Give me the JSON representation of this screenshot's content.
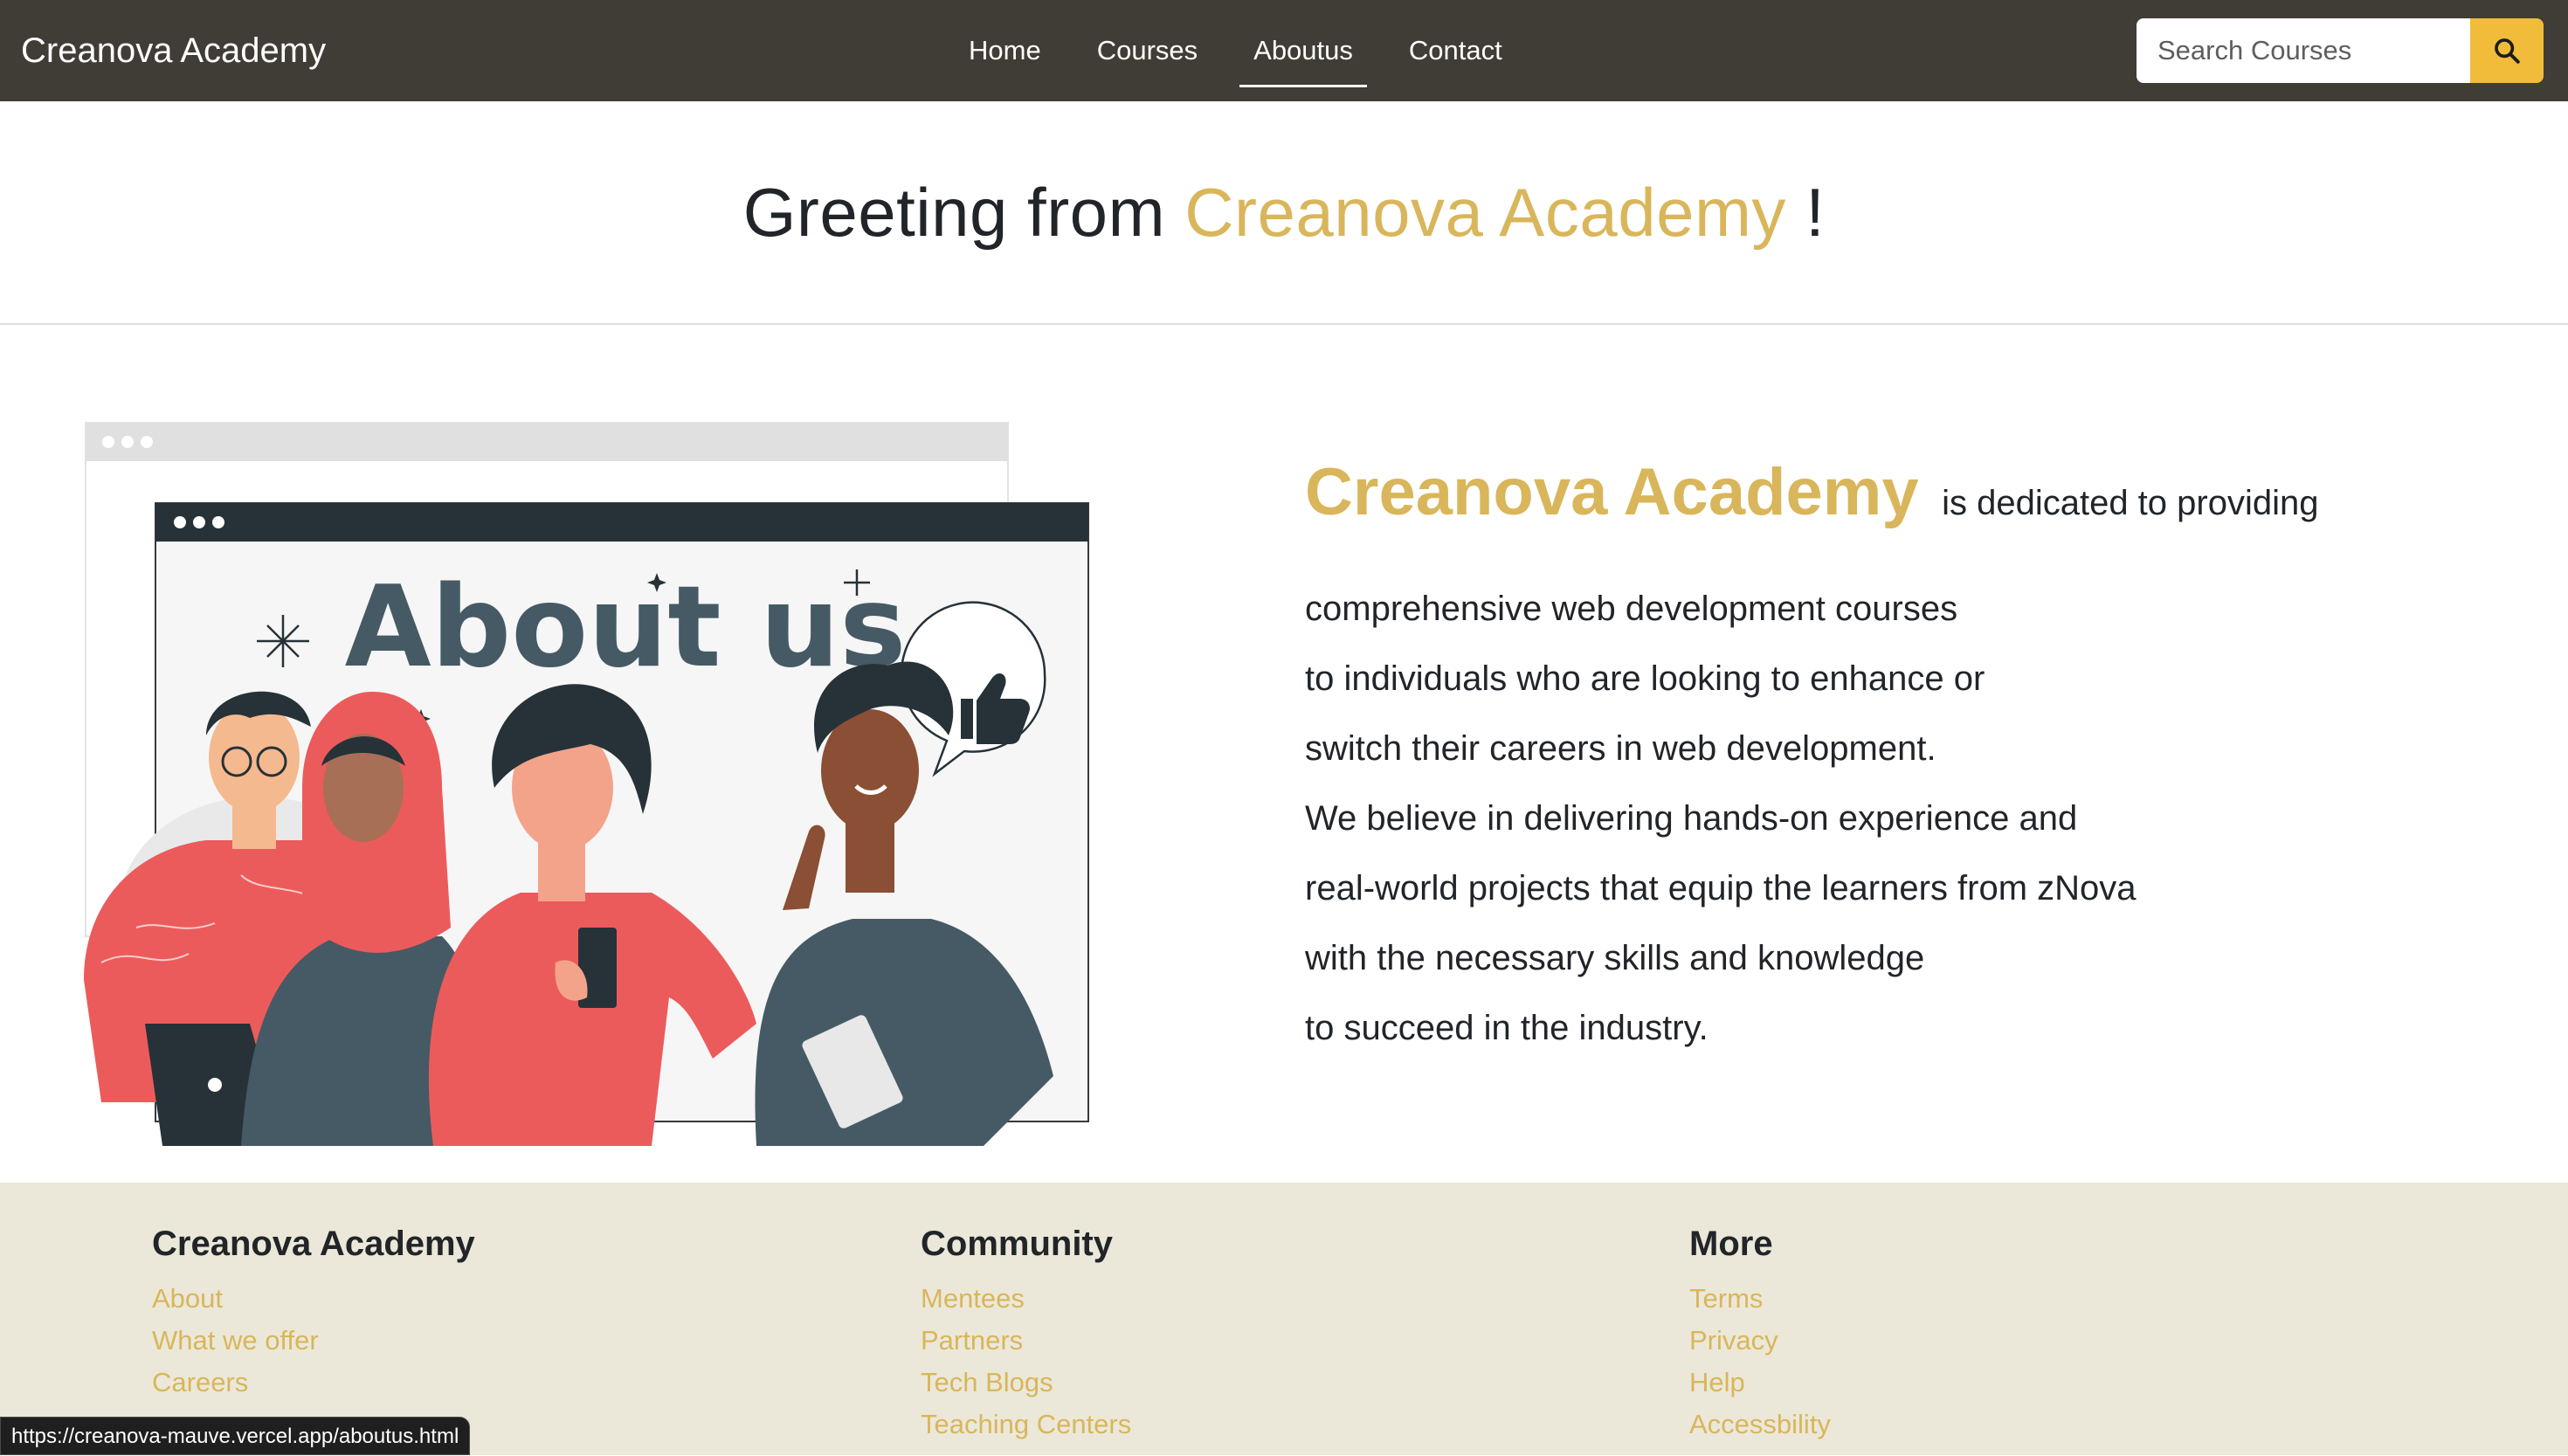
{
  "navbar": {
    "brand": "Creanova Academy",
    "links": [
      {
        "label": "Home"
      },
      {
        "label": "Courses"
      },
      {
        "label": "Aboutus"
      },
      {
        "label": "Contact"
      }
    ],
    "active_link": "Aboutus",
    "search_placeholder": "Search Courses",
    "search_icon": "search-icon"
  },
  "greeting": {
    "prefix": "Greeting from",
    "brand": "Creanova Academy",
    "suffix": "!"
  },
  "illustration": {
    "title": "About us"
  },
  "about": {
    "brand": "Creanova Academy",
    "lead": "is dedicated to providing",
    "lines": [
      "comprehensive web development courses",
      "to individuals who are looking to enhance or",
      "switch their careers in web development.",
      "We believe in delivering hands-on experience and",
      "real-world projects that equip the learners from zNova",
      "with the necessary skills and knowledge",
      "to succeed in the industry."
    ]
  },
  "footer": {
    "columns": [
      {
        "title": "Creanova Academy",
        "links": [
          "About",
          "What we offer",
          "Careers"
        ]
      },
      {
        "title": "Community",
        "links": [
          "Mentees",
          "Partners",
          "Tech Blogs",
          "Teaching Centers"
        ]
      },
      {
        "title": "More",
        "links": [
          "Terms",
          "Privacy",
          "Help",
          "Accessbility"
        ]
      }
    ]
  },
  "status_bar": {
    "url": "https://creanova-mauve.vercel.app/aboutus.html"
  },
  "colors": {
    "navbar_bg": "#403c36",
    "accent_gold": "#d9b65b",
    "search_button": "#f0bc3a",
    "footer_bg": "#ebe8d9",
    "illustration_coral": "#ec5b5b",
    "illustration_slate": "#455a64"
  }
}
